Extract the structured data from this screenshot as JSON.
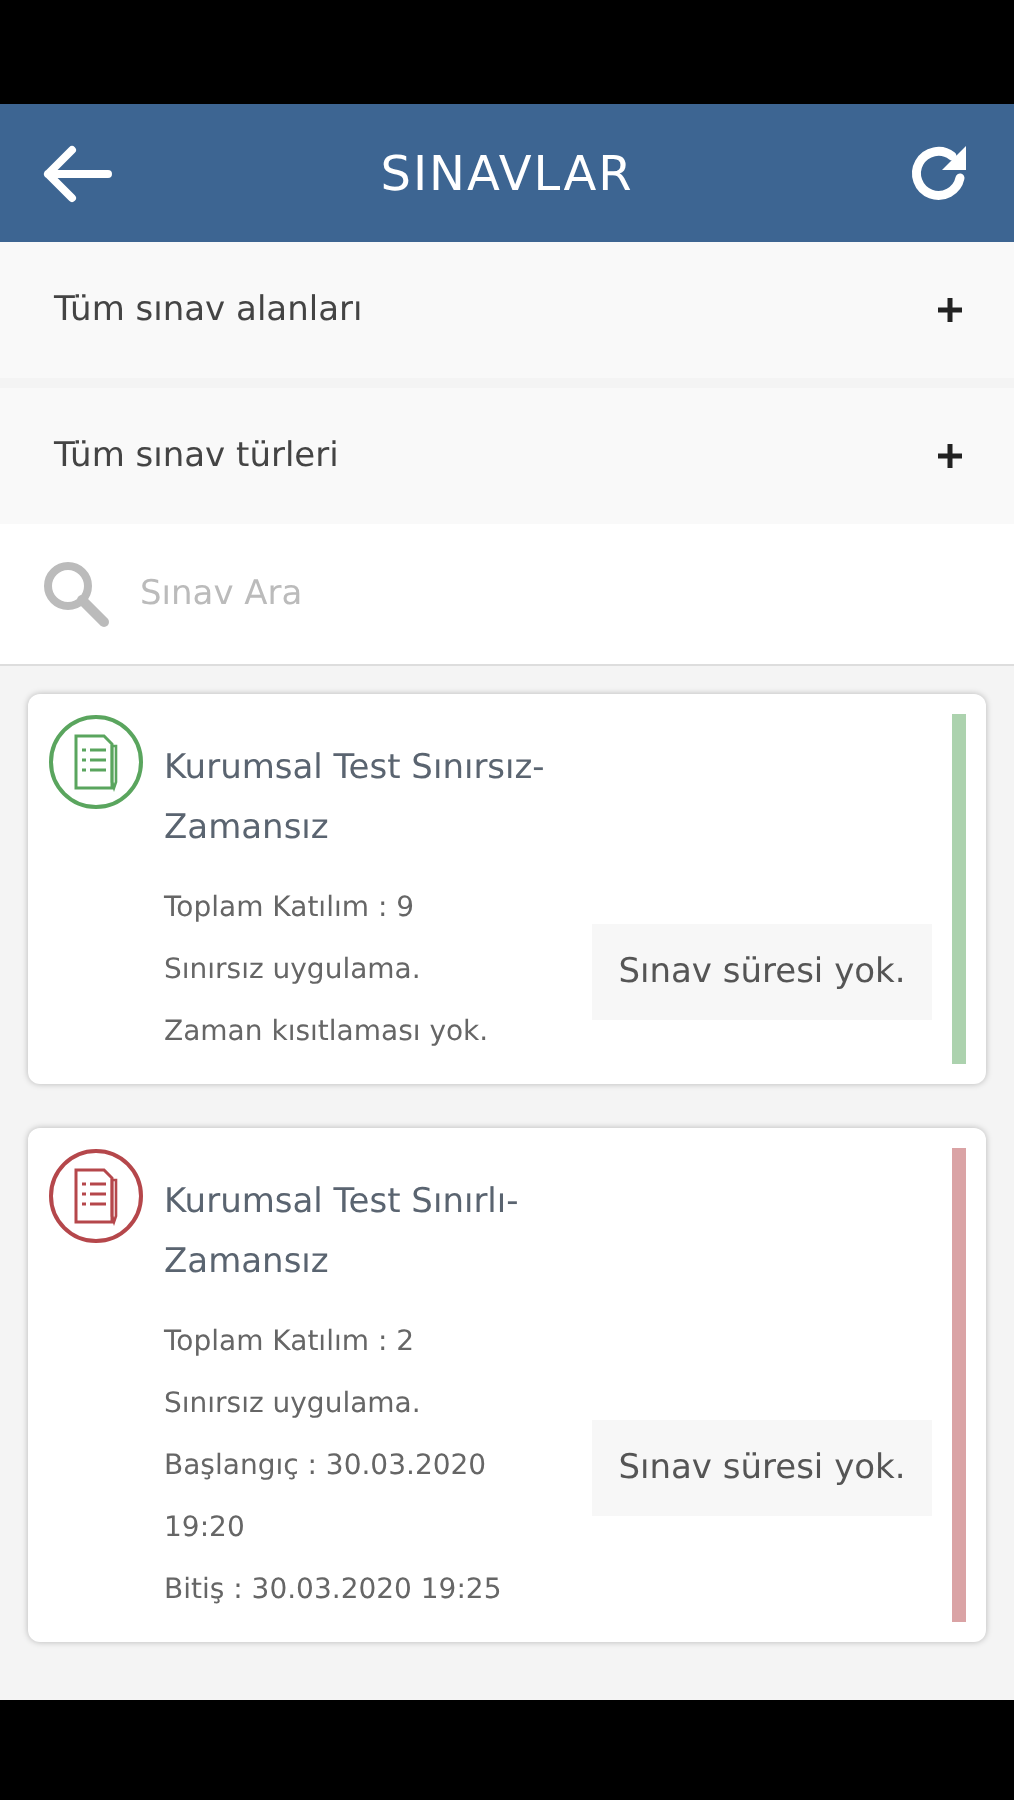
{
  "header": {
    "title": "SINAVLAR"
  },
  "filters": [
    {
      "label": "Tüm sınav alanları",
      "expanded": false
    },
    {
      "label": "Tüm sınav türleri",
      "expanded": false
    }
  ],
  "search": {
    "placeholder": "Sınav Ara"
  },
  "exams": [
    {
      "title": "Kurumsal Test Sınırsız-Zamansız",
      "color": "#5aa55e",
      "lines": [
        "Toplam Katılım : 9",
        "Sınırsız uygulama.",
        "Zaman kısıtlaması yok."
      ],
      "duration": "Sınav süresi yok."
    },
    {
      "title": "Kurumsal Test Sınırlı-Zamansız",
      "color": "#b5474b",
      "lines": [
        "Toplam Katılım : 2",
        "Sınırsız uygulama.",
        "Başlangıç : 30.03.2020 19:20",
        "Bitiş : 30.03.2020 19:25"
      ],
      "duration": "Sınav süresi yok."
    }
  ]
}
